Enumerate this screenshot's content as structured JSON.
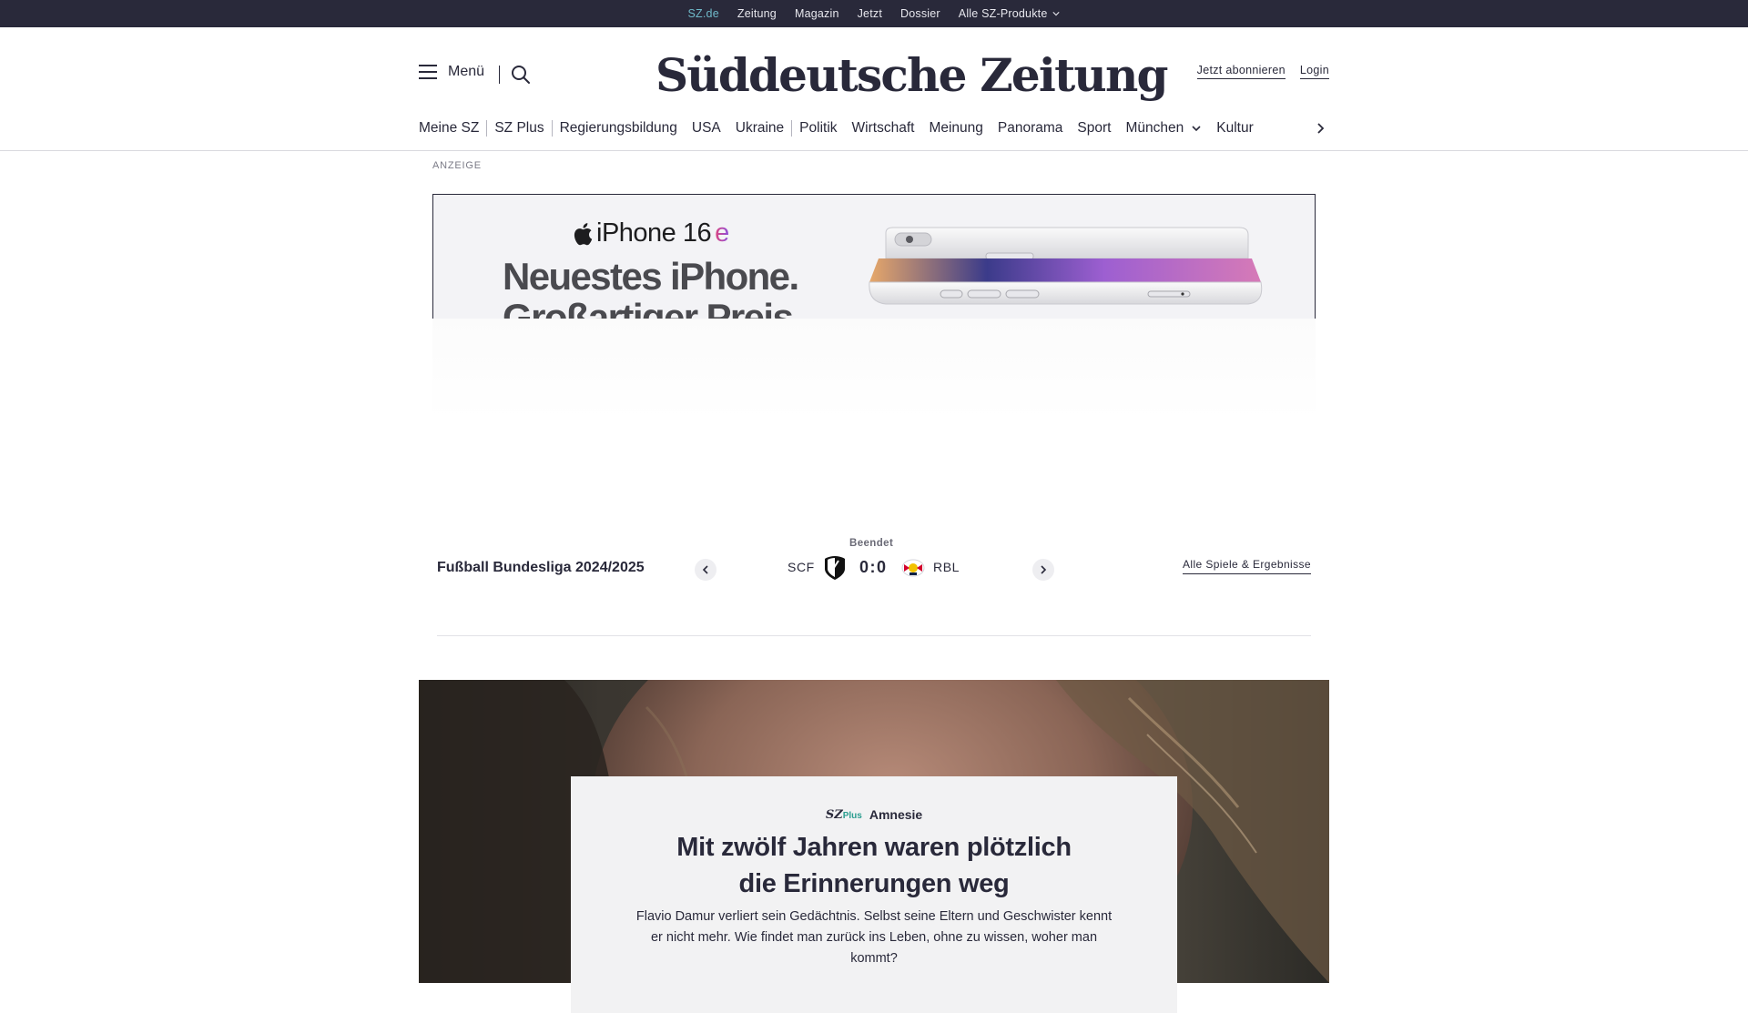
{
  "topbar": {
    "items": [
      {
        "label": "SZ.de"
      },
      {
        "label": "Zeitung"
      },
      {
        "label": "Magazin"
      },
      {
        "label": "Jetzt"
      },
      {
        "label": "Dossier"
      },
      {
        "label": "Alle SZ-Produkte"
      }
    ]
  },
  "header": {
    "menu_label": "Menü",
    "logo_text": "Süddeutsche Zeitung",
    "subscribe_label": "Jetzt abonnieren",
    "login_label": "Login"
  },
  "nav": {
    "items": [
      {
        "label": "Meine SZ"
      },
      {
        "label": "SZ Plus"
      },
      {
        "label": "Regierungsbildung"
      },
      {
        "label": "USA"
      },
      {
        "label": "Ukraine"
      },
      {
        "label": "Politik"
      },
      {
        "label": "Wirtschaft"
      },
      {
        "label": "Meinung"
      },
      {
        "label": "Panorama"
      },
      {
        "label": "Sport"
      },
      {
        "label": "München"
      },
      {
        "label": "Kultur"
      }
    ]
  },
  "ad": {
    "label": "ANZEIGE",
    "brand_prefix": "iPhone 16",
    "brand_suffix": "e",
    "headline1": "Neuestes iPhone.",
    "headline2": "Großartiger Preis."
  },
  "ticker": {
    "league": "Fußball Bundesliga 2024/2025",
    "status": "Beendet",
    "home_team": "SCF",
    "score": "0:0",
    "away_team": "RBL",
    "all_games_label": "Alle Spiele & Ergebnisse"
  },
  "teaser": {
    "brand": "SZ",
    "brand_plus": "Plus",
    "topic": "Amnesie",
    "headline_line1": "Mit zwölf Jahren waren plötzlich",
    "headline_line2": "die Erinnerungen weg",
    "summary": "Flavio Damur verliert sein Gedächtnis. Selbst seine Eltern und Geschwister kennt er nicht mehr. Wie findet man zurück ins Leben, ohne zu wissen, woher man kommt?"
  },
  "colors": {
    "topbar_bg": "#29293a",
    "active_link": "#6fb9c9",
    "text": "#29293a",
    "szplus_accent": "#2a9d8f"
  }
}
